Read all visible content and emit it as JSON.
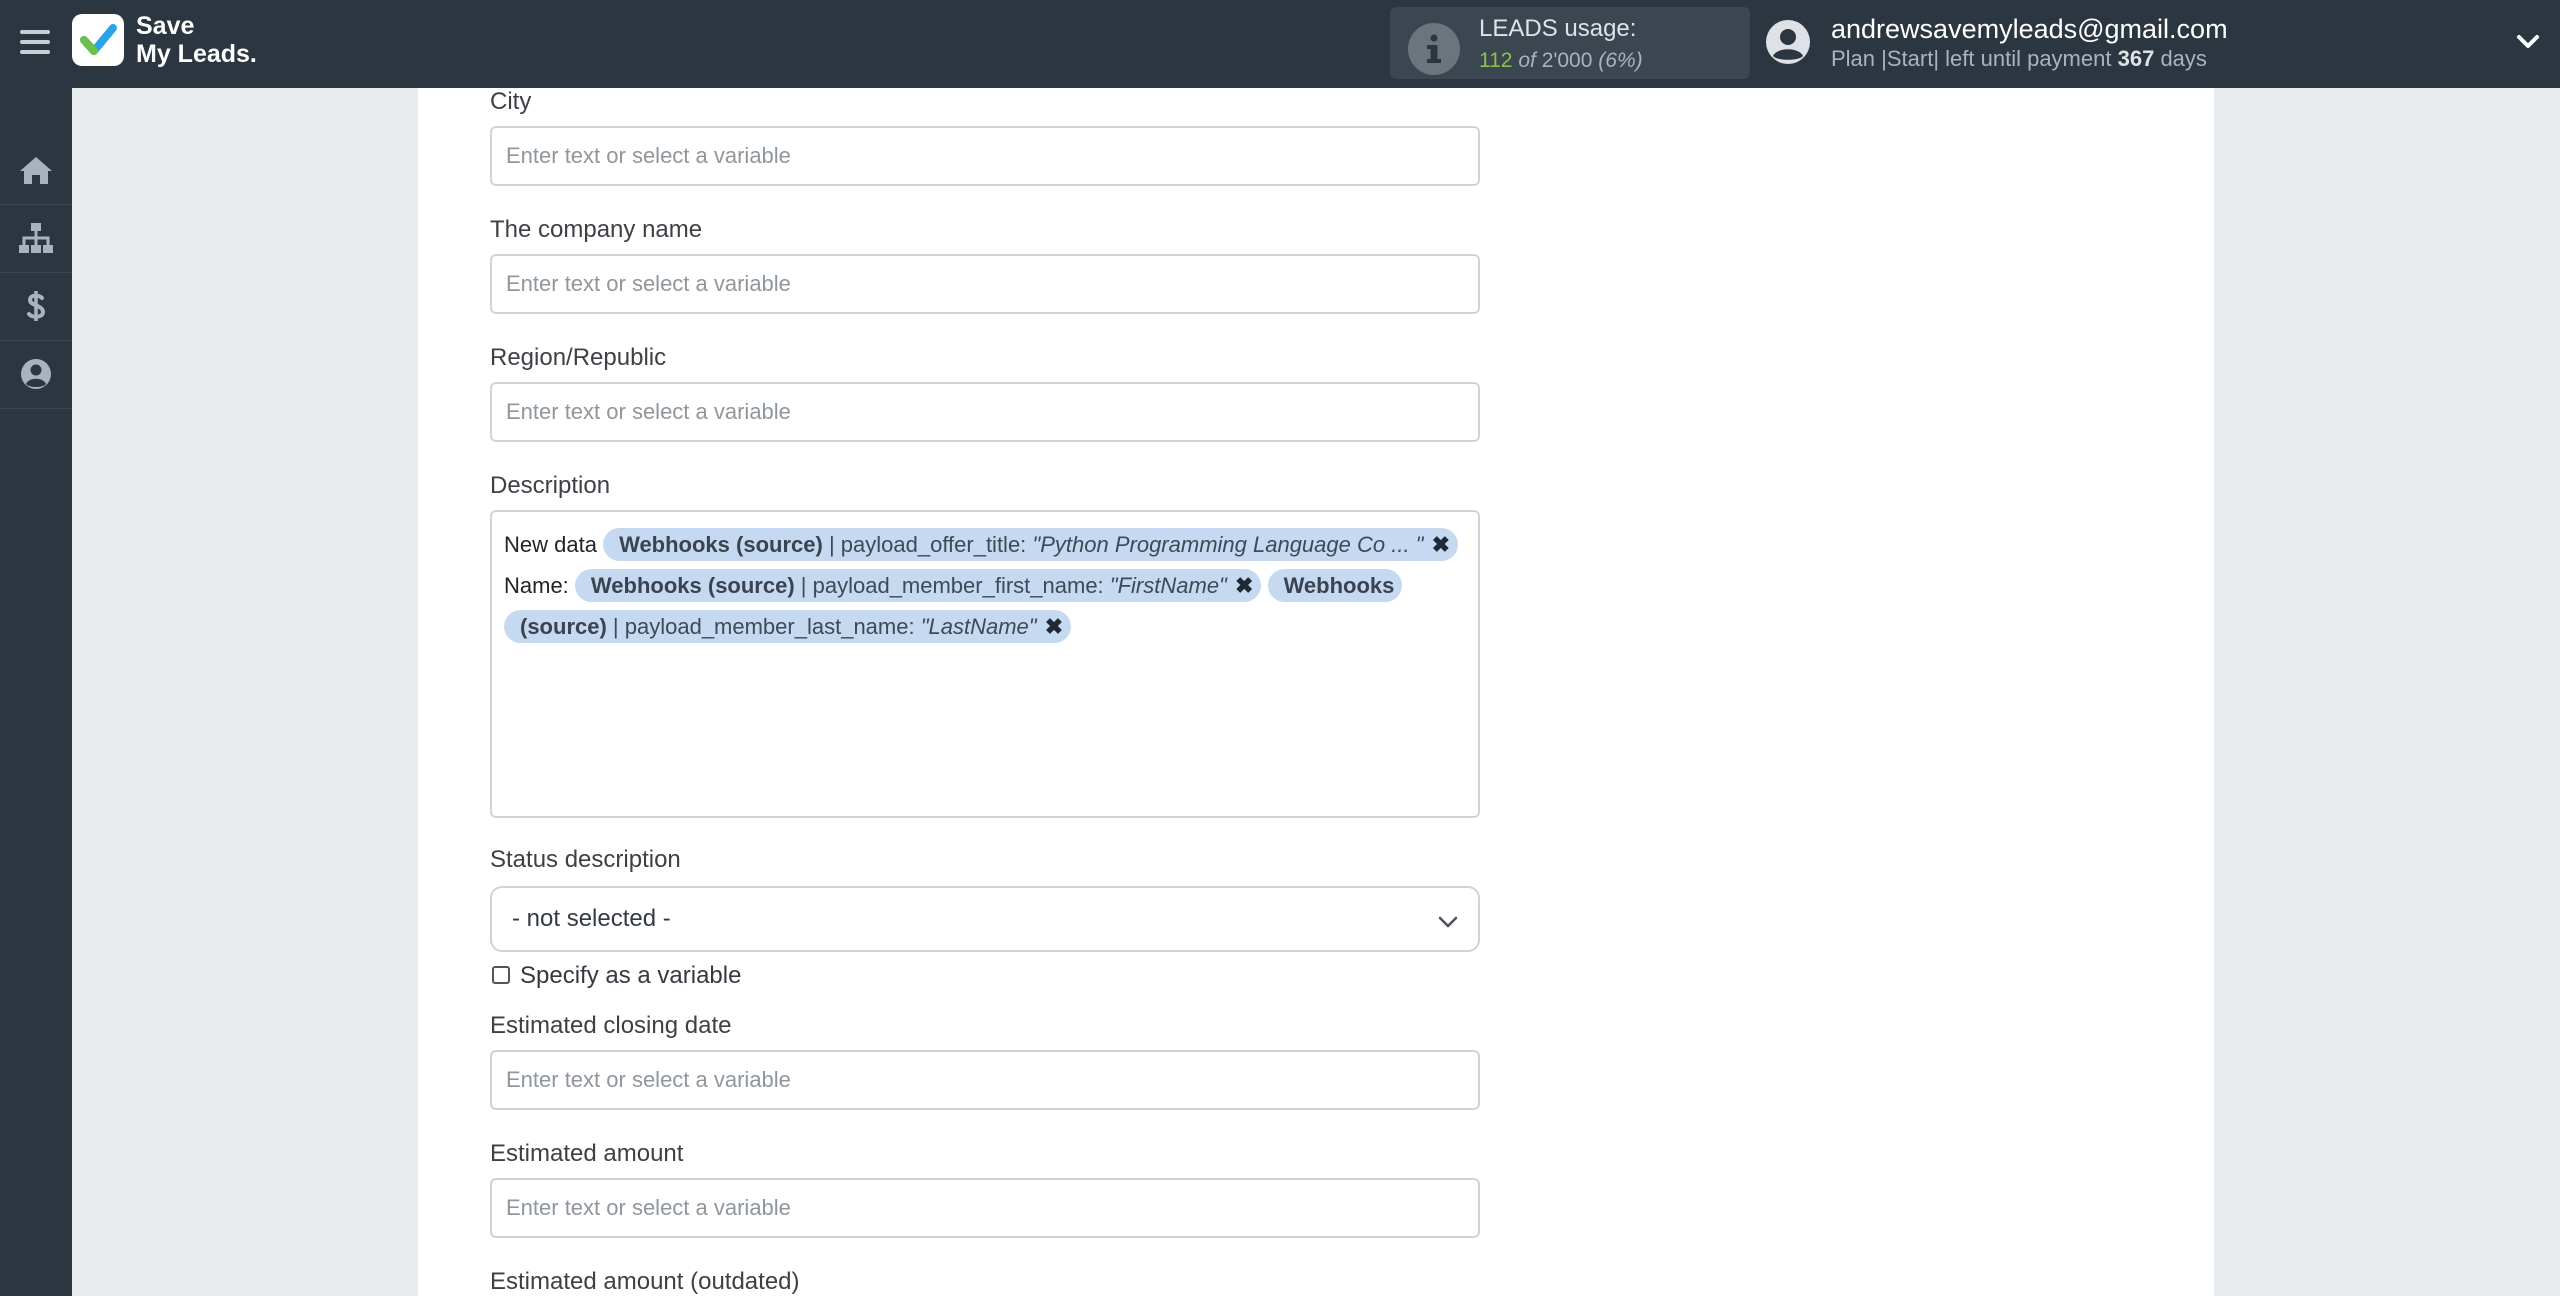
{
  "header": {
    "logo_line1": "Save",
    "logo_line2": "My Leads.",
    "usage": {
      "title": "LEADS usage:",
      "used": "112",
      "of_label": "of",
      "limit": "2'000",
      "percent": "(6%)"
    },
    "user": {
      "email": "andrewsavemyleads@gmail.com",
      "plan_prefix": "Plan |Start| left until payment",
      "days": "367",
      "days_suffix": "days"
    }
  },
  "sidebar": {
    "items": [
      {
        "icon": "home-icon"
      },
      {
        "icon": "sitemap-icon"
      },
      {
        "icon": "dollar-icon"
      },
      {
        "icon": "user-circle-icon"
      }
    ]
  },
  "form": {
    "placeholder": "Enter text or select a variable",
    "city_label": "City",
    "company_label": "The company name",
    "region_label": "Region/Republic",
    "description_label": "Description",
    "description": {
      "line1_text": "New data",
      "tag1": {
        "source": "Webhooks (source)",
        "field": "| payload_offer_title:",
        "value": "\"Python Programming Language Co ... \""
      },
      "line2_text": "Name:",
      "tag2": {
        "source": "Webhooks (source)",
        "field": "| payload_member_first_name:",
        "value": "\"FirstName\""
      },
      "tag3": {
        "source": "Webhooks (source)",
        "field": "| payload_member_last_name:",
        "value": "\"LastName\""
      },
      "remove_symbol": "✖"
    },
    "status_label": "Status description",
    "status_value": "- not selected -",
    "specify_variable_label": "Specify as a variable",
    "closing_date_label": "Estimated closing date",
    "amount_label": "Estimated amount",
    "amount_outdated_label": "Estimated amount (outdated)"
  },
  "colors": {
    "topbar_bg": "#2c3640",
    "accent_green": "#8bc34a",
    "tag_bg": "#c5d9f1",
    "page_bg": "#e9ecef"
  }
}
